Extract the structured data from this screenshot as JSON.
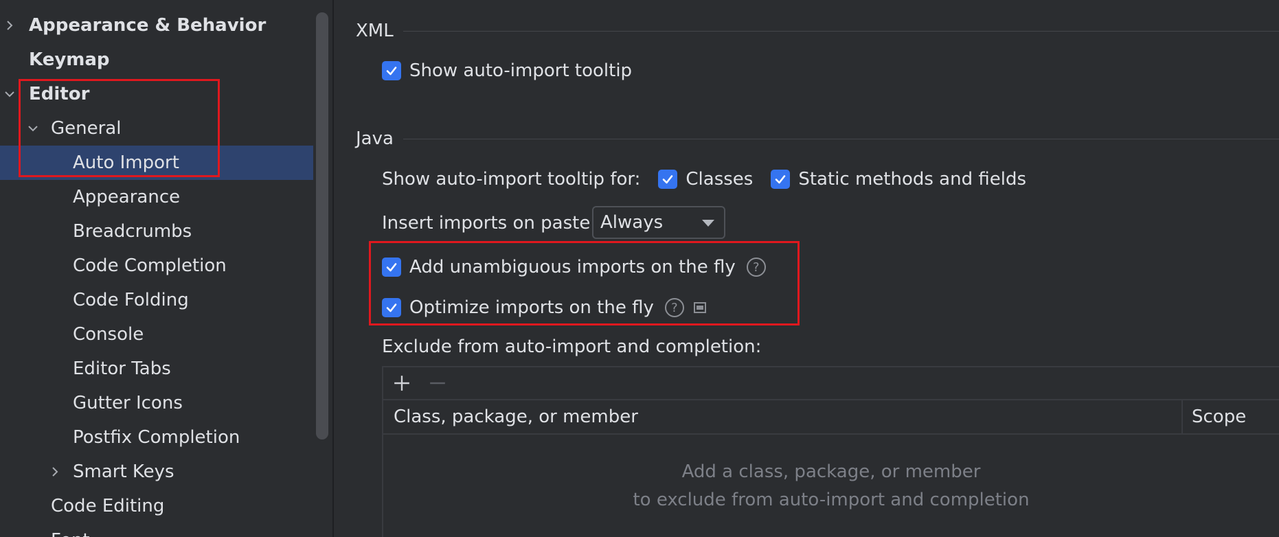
{
  "sidebar": {
    "items": [
      {
        "label": "Appearance & Behavior",
        "bold": true,
        "expander": "right",
        "indent": 0
      },
      {
        "label": "Keymap",
        "bold": true,
        "expander": "",
        "indent": 0
      },
      {
        "label": "Editor",
        "bold": true,
        "expander": "down",
        "indent": 0
      },
      {
        "label": "General",
        "bold": false,
        "expander": "down",
        "indent": 1
      },
      {
        "label": "Auto Import",
        "bold": false,
        "expander": "",
        "indent": 2,
        "selected": true
      },
      {
        "label": "Appearance",
        "bold": false,
        "expander": "",
        "indent": 2
      },
      {
        "label": "Breadcrumbs",
        "bold": false,
        "expander": "",
        "indent": 2
      },
      {
        "label": "Code Completion",
        "bold": false,
        "expander": "",
        "indent": 2
      },
      {
        "label": "Code Folding",
        "bold": false,
        "expander": "",
        "indent": 2
      },
      {
        "label": "Console",
        "bold": false,
        "expander": "",
        "indent": 2
      },
      {
        "label": "Editor Tabs",
        "bold": false,
        "expander": "",
        "indent": 2
      },
      {
        "label": "Gutter Icons",
        "bold": false,
        "expander": "",
        "indent": 2
      },
      {
        "label": "Postfix Completion",
        "bold": false,
        "expander": "",
        "indent": 2
      },
      {
        "label": "Smart Keys",
        "bold": false,
        "expander": "right",
        "indent": 2
      },
      {
        "label": "Code Editing",
        "bold": false,
        "expander": "",
        "indent": 1
      },
      {
        "label": "Font",
        "bold": false,
        "expander": "",
        "indent": 1
      }
    ]
  },
  "xml": {
    "section_title": "XML",
    "show_tooltip_label": "Show auto-import tooltip",
    "show_tooltip_checked": true
  },
  "java": {
    "section_title": "Java",
    "tooltip_for_label": "Show auto-import tooltip for:",
    "classes_label": "Classes",
    "classes_checked": true,
    "static_label": "Static methods and fields",
    "static_checked": true,
    "insert_imports_label": "Insert imports on paste:",
    "insert_imports_value": "Always",
    "add_unambiguous_label": "Add unambiguous imports on the fly",
    "add_unambiguous_checked": true,
    "optimize_label": "Optimize imports on the fly",
    "optimize_checked": true,
    "help_glyph": "?",
    "exclude_label": "Exclude from auto-import and completion:",
    "exclude_table": {
      "columns": [
        "Class, package, or member",
        "Scope"
      ],
      "empty_line1": "Add a class, package, or member",
      "empty_line2": "to exclude from auto-import and completion"
    }
  },
  "colors": {
    "accent": "#3574f0",
    "selection": "#2e436e",
    "highlight_box": "#e0181e",
    "background": "#2b2d30"
  },
  "icons": [
    "chevron-right-icon",
    "chevron-down-icon",
    "checkmark-icon",
    "help-icon",
    "doc-preview-icon",
    "plus-icon",
    "minus-icon",
    "dropdown-arrow-icon"
  ]
}
